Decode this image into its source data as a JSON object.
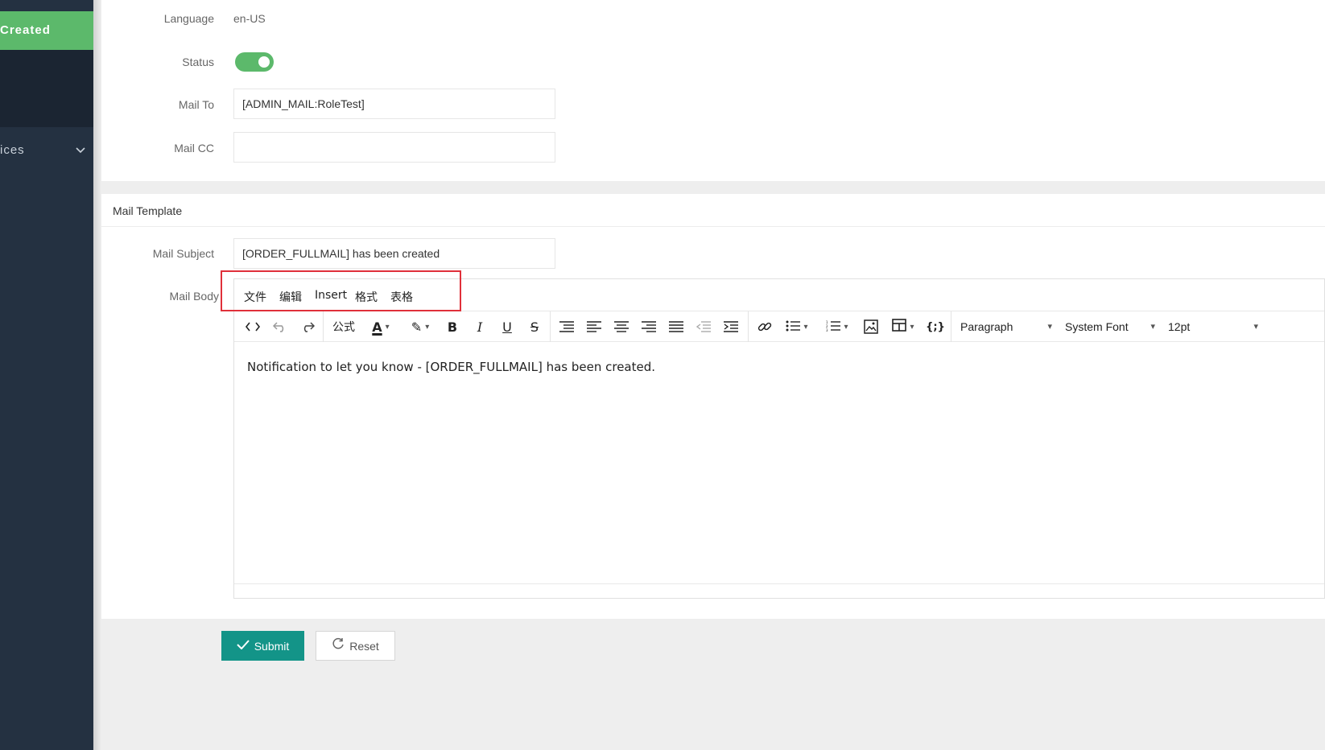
{
  "sidebar": {
    "active_item": "Created",
    "group_item": "ices"
  },
  "form": {
    "language_label": "Language",
    "language_value": "en-US",
    "status_label": "Status",
    "status_on": true,
    "mail_to_label": "Mail To",
    "mail_to_value": "[ADMIN_MAIL:RoleTest]",
    "mail_cc_label": "Mail CC",
    "mail_cc_value": ""
  },
  "template": {
    "section_title": "Mail Template",
    "subject_label": "Mail Subject",
    "subject_value": "[ORDER_FULLMAIL] has been created",
    "body_label": "Mail Body"
  },
  "editor": {
    "menus": [
      "文件",
      "编辑",
      "Insert",
      "格式",
      "表格"
    ],
    "formula_label": "公式",
    "block_format": "Paragraph",
    "font_family": "System Font",
    "font_size": "12pt",
    "body_text": "Notification to let you know - [ORDER_FULLMAIL] has been created."
  },
  "actions": {
    "submit_label": "Submit",
    "reset_label": "Reset"
  },
  "colors": {
    "sidebar_bg": "#243141",
    "sidebar_active": "#5cb96b",
    "primary_button": "#139488",
    "highlight_border": "#e0303a"
  }
}
